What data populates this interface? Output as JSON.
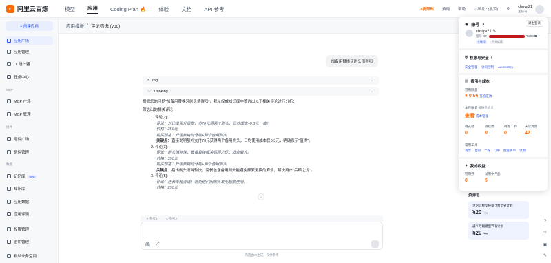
{
  "brand": {
    "name": "阿里云百炼"
  },
  "topnav": [
    "模型",
    "应用",
    "Coding Plan",
    "体验",
    "文档",
    "API 参考"
  ],
  "topnav_active": 1,
  "topright": {
    "promo": "6折限时",
    "links": [
      "费用",
      "帮助"
    ],
    "workspace": "华北2 (北京)"
  },
  "user": {
    "name": "chuya21",
    "role": "主账号"
  },
  "sidebar": {
    "create_label": "+ 创建应用",
    "items": [
      {
        "label": "应用广场",
        "active": true
      },
      {
        "label": "应用管理"
      },
      {
        "label": "UI 设计器"
      },
      {
        "label": "任务中心"
      }
    ],
    "group_mcp": "MCP",
    "mcp_items": [
      {
        "label": "MCP 广场"
      },
      {
        "label": "MCP 管理"
      }
    ],
    "group_components": "组件",
    "component_items": [
      {
        "label": "组件广场"
      },
      {
        "label": "组件管理"
      }
    ],
    "group_data": "数据",
    "data_items": [
      {
        "label": "记忆库",
        "badge": "New"
      },
      {
        "label": "知识库"
      },
      {
        "label": "应用数据"
      },
      {
        "label": "应用评测"
      }
    ],
    "bottom_items": [
      {
        "label": "权限管理"
      },
      {
        "label": "密钥管理"
      },
      {
        "label": "默认业务空间"
      }
    ]
  },
  "breadcrumb": {
    "parent": "应用模板",
    "sep": "/",
    "current": "评论筛选 (voc)"
  },
  "chat": {
    "user_message": "加备用替换牙刷头值得吗",
    "rag_label": "rag",
    "thinking_label": "Thinking",
    "intro": "根据您的问题\"加备用替换牙刷头值得吗\"，我从权威知识库中筛选出以下相关评论进行分析：",
    "subhead": "筛选出的相关评论：",
    "reviews": [
      {
        "no": "1. 评论[2]:",
        "review": "评论：对比单买升级款，多70元得两个刷头，日均成本≈0.3元，值！",
        "price": "价格：250元",
        "buy": "购买规格：升级款电动牙刷+两个备用刷头",
        "key_label": "关键点：",
        "key": "直接说明额外支付70元获得两个备用刷头，日均使用成本仅0.3元，明确表示\"值得\"。"
      },
      {
        "no": "2. 评论[3]:",
        "review": "评论：刷头消耗快，套餐直接解决后顾之忧，适合懒人。",
        "price": "价格：350元",
        "buy": "购买规格：升级款电动牙刷+两个备用刷头",
        "key_label": "关键点：",
        "key": "指出刷头消耗较快，套餐包含备用刷头能避免频繁更换的麻烦，解决用户\"后顾之忧\"。"
      },
      {
        "no": "3. 评论[5]:",
        "review": "评论：送长辈超合适！避免他们因刷头发毛超期使用。",
        "price": "价格：250元"
      }
    ],
    "doc_tabs": [
      "参考1",
      "参考2"
    ],
    "input_icons": [
      "paperclip-icon",
      "expand-icon"
    ],
    "send_icon": "arrow-up-icon",
    "footer": "内容由AI生成，仅供参考"
  },
  "resources": {
    "title": "资源包",
    "cards": [
      {
        "title": "大语言模型按量计费节省计划",
        "price": "¥20",
        "orig": "¥70"
      },
      {
        "title": "通义万相模型节省计划",
        "price": "¥20",
        "orig": "¥70"
      }
    ]
  },
  "popup": {
    "title": "账号",
    "logout": "退出登录",
    "account_name": "chuya21",
    "account_id_prefix": "账号 ID：",
    "account_id_suffix": "78293",
    "tags": [
      "主账号",
      "个人认证"
    ],
    "perm_title": "权限与安全",
    "perm_links": [
      "安全管理",
      "访问控制",
      "AccessKey"
    ],
    "cost_title": "费用与成本",
    "quota_label": "可用额度",
    "quota_value": "¥ 0.96",
    "quota_link": "充值汇款",
    "month_label": "本月账单",
    "month_note": "按账单统计",
    "month_link1": "查看",
    "month_link2": "成本管理",
    "stats": [
      {
        "label": "待支付",
        "value": "0"
      },
      {
        "label": "待续费",
        "value": "0"
      },
      {
        "label": "待办工单",
        "value": "0"
      },
      {
        "label": "未读消息",
        "value": "42"
      }
    ],
    "tools_label": "常用工具",
    "tools": [
      "发票",
      "合同",
      "卡券",
      "订单",
      "配置清单",
      "试用"
    ],
    "benefit_title": "我的权益",
    "benefit_stats": [
      {
        "label": "可用券",
        "value": "0"
      },
      {
        "label": "试用中产品",
        "value": "5"
      }
    ]
  }
}
